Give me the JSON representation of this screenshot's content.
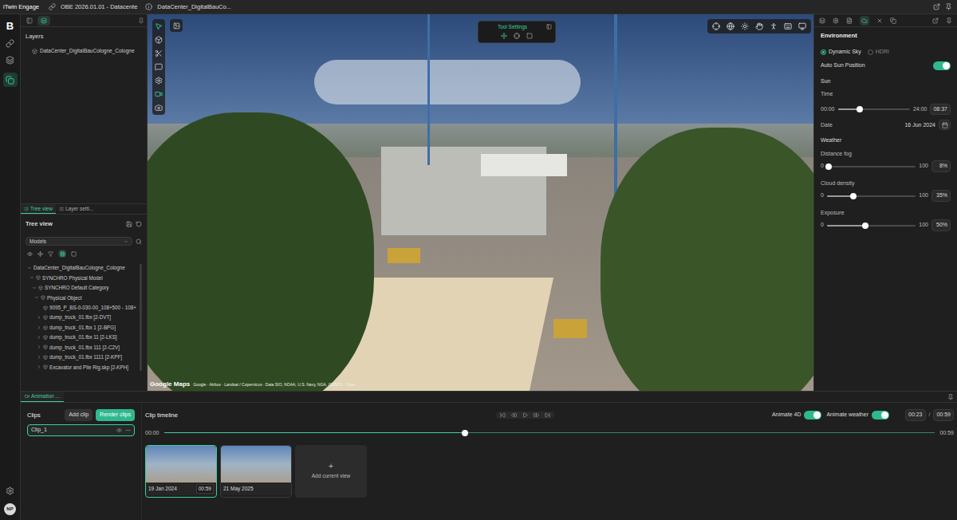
{
  "title_bar": {
    "app": "iTwin Engage",
    "project": "OBE 2026.01.01 - Datacente",
    "model": "DataCenter_DigitalBauCo..."
  },
  "rail": {
    "logo": "B",
    "avatar": "NP"
  },
  "left_panel": {
    "layers_title": "Layers",
    "layers": [
      "DataCenter_DigitalBauCologne_Cologne"
    ],
    "tabs": [
      {
        "label": "Tree view",
        "selected": true
      },
      {
        "label": "Layer setti...",
        "selected": false
      }
    ],
    "tree_title": "Tree view",
    "models_select": "Models",
    "tree": [
      {
        "label": "DataCenter_DigitalBauCologne_Cologne",
        "depth": 0,
        "kind": "node",
        "expanded": true
      },
      {
        "label": "SYNCHRO Physical Model",
        "depth": 1,
        "kind": "node",
        "expanded": true
      },
      {
        "label": "SYNCHRO Default Category",
        "depth": 2,
        "kind": "node",
        "expanded": true
      },
      {
        "label": "Physical Object",
        "depth": 3,
        "kind": "node",
        "expanded": true
      },
      {
        "label": "9095_P_BS-0-030-00_108+500 - 108+",
        "depth": 4,
        "kind": "leaf",
        "expanded": false
      },
      {
        "label": "dump_truck_01.fbx [2-DVT]",
        "depth": 4,
        "kind": "node",
        "expanded": false
      },
      {
        "label": "dump_truck_01.fbx 1 [2-BPG]",
        "depth": 4,
        "kind": "node",
        "expanded": false
      },
      {
        "label": "dump_truck_01.fbx 11 [2-LKS]",
        "depth": 4,
        "kind": "node",
        "expanded": false
      },
      {
        "label": "dump_truck_01.fbx 111 [2-C2V]",
        "depth": 4,
        "kind": "node",
        "expanded": false
      },
      {
        "label": "dump_truck_01.fbx 1111 [2-KPF]",
        "depth": 4,
        "kind": "node",
        "expanded": false
      },
      {
        "label": "Excavator and Pile Rig.skp [2-KPH]",
        "depth": 4,
        "kind": "node",
        "expanded": false
      }
    ]
  },
  "viewport": {
    "tool_settings_title": "Tool Settings",
    "attribution_logo": "Google Maps",
    "attribution": "Google · Airbus · Landsat / Copernicus · Data SIO, NOAA, U.S. Navy, NGA, GEBCO · Data..."
  },
  "environment": {
    "title": "Environment",
    "sky_modes": [
      {
        "label": "Dynamic Sky",
        "selected": true
      },
      {
        "label": "HDRI",
        "selected": false
      }
    ],
    "auto_sun": {
      "label": "Auto Sun Position",
      "on": true
    },
    "sun_title": "Sun",
    "time": {
      "label": "Time",
      "min": "00:00",
      "max": "24:00",
      "value": "08:37",
      "level": 0.3
    },
    "date": {
      "label": "Date",
      "value": "16 Jun 2024"
    },
    "weather_title": "Weather",
    "weather": [
      {
        "label": "Distance fog",
        "min": "0",
        "max": "100",
        "value": "8%",
        "level": 0.02
      },
      {
        "label": "Cloud density",
        "min": "0",
        "max": "100",
        "value": "35%",
        "level": 0.3
      },
      {
        "label": "Exposure",
        "min": "0",
        "max": "100",
        "value": "50%",
        "level": 0.43
      }
    ]
  },
  "animation": {
    "tab": "Animation ...",
    "clips_title": "Clips",
    "add_clip": "Add clip",
    "render_clips": "Render clips",
    "clips": [
      {
        "name": "Clip_1",
        "selected": true
      }
    ],
    "timeline_title": "Clip timeline",
    "animate_4d": {
      "label": "Animate 4D",
      "on": true
    },
    "animate_weather": {
      "label": "Animate weather",
      "on": true
    },
    "current_time": "00:23",
    "separator": "/",
    "total_time": "00:59",
    "track": {
      "start": "00:00",
      "end": "00:59",
      "level": 0.39
    },
    "keyframes": [
      {
        "date": "19 Jan 2024",
        "duration": "00:59",
        "selected": true
      },
      {
        "date": "21 May 2025",
        "duration": "",
        "selected": false
      }
    ],
    "add_view": {
      "icon": "+",
      "label": "Add current view"
    }
  }
}
